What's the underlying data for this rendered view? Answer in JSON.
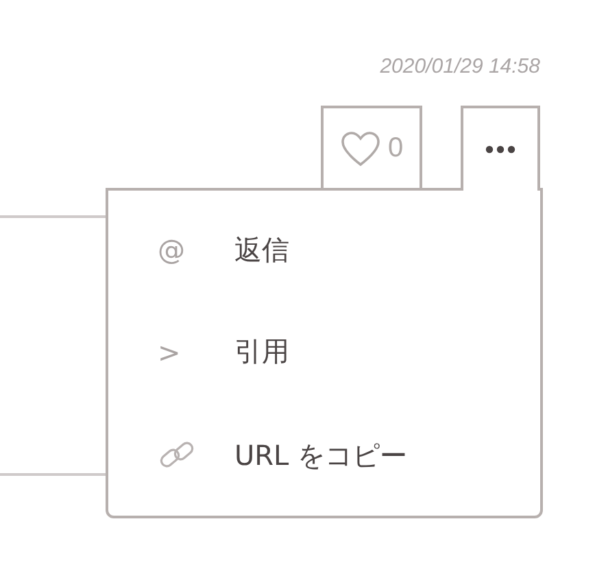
{
  "timestamp": "2020/01/29 14:58",
  "like": {
    "count": "0",
    "liked": false
  },
  "more_button": {
    "expanded": true
  },
  "menu": {
    "items": [
      {
        "kind": "glyph",
        "icon": "@",
        "label": "返信"
      },
      {
        "kind": "glyph",
        "icon": ">",
        "label": "引用"
      },
      {
        "kind": "link",
        "label": "URL をコピー"
      }
    ]
  }
}
